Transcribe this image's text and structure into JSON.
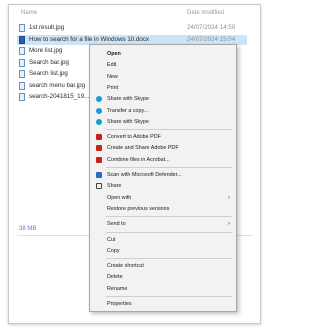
{
  "header": {
    "name": "Name",
    "date": "Date modified"
  },
  "files": [
    {
      "name": "1st result.jpg",
      "date": "24/07/2024 14:50",
      "selected": false,
      "icon": "image-file-icon"
    },
    {
      "name": "How to search for a file in Windows 10.docx",
      "date": "24/07/2024 15:04",
      "selected": true,
      "icon": "word-file-icon"
    },
    {
      "name": "More list.jpg",
      "date": "",
      "selected": false,
      "icon": "image-file-icon"
    },
    {
      "name": "Search bar.jpg",
      "date": "",
      "selected": false,
      "icon": "image-file-icon"
    },
    {
      "name": "Search list.jpg",
      "date": "",
      "selected": false,
      "icon": "image-file-icon"
    },
    {
      "name": "search menu bar.jpg",
      "date": "",
      "selected": false,
      "icon": "image-file-icon"
    },
    {
      "name": "search-2041815_19...",
      "date": "",
      "selected": false,
      "icon": "image-file-icon"
    }
  ],
  "status": {
    "size": "38 MB"
  },
  "menu": {
    "items": [
      {
        "label": "Open",
        "bold": true,
        "icon": "",
        "arrow": false,
        "sep_before": false
      },
      {
        "label": "Edit",
        "bold": false,
        "icon": "",
        "arrow": false,
        "sep_before": false
      },
      {
        "label": "New",
        "bold": false,
        "icon": "",
        "arrow": false,
        "sep_before": false
      },
      {
        "label": "Print",
        "bold": false,
        "icon": "",
        "arrow": false,
        "sep_before": false
      },
      {
        "label": "Share with Skype",
        "bold": false,
        "icon": "skype",
        "arrow": false,
        "sep_before": false
      },
      {
        "label": "Transfer a copy...",
        "bold": false,
        "icon": "skype",
        "arrow": false,
        "sep_before": false
      },
      {
        "label": "Share with Skype",
        "bold": false,
        "icon": "skype",
        "arrow": false,
        "sep_before": false
      },
      {
        "label": "Convert to Adobe PDF",
        "bold": false,
        "icon": "pdf",
        "arrow": false,
        "sep_before": true
      },
      {
        "label": "Create and Share Adobe PDF",
        "bold": false,
        "icon": "pdf",
        "arrow": false,
        "sep_before": false
      },
      {
        "label": "Combine files in Acrobat...",
        "bold": false,
        "icon": "pdf",
        "arrow": false,
        "sep_before": false
      },
      {
        "label": "Scan with Microsoft Defender...",
        "bold": false,
        "icon": "defender",
        "arrow": false,
        "sep_before": true
      },
      {
        "label": "Share",
        "bold": false,
        "icon": "share",
        "arrow": false,
        "sep_before": false
      },
      {
        "label": "Open with",
        "bold": false,
        "icon": "",
        "arrow": true,
        "sep_before": false
      },
      {
        "label": "Restore previous versions",
        "bold": false,
        "icon": "",
        "arrow": false,
        "sep_before": false
      },
      {
        "label": "Send to",
        "bold": false,
        "icon": "",
        "arrow": true,
        "sep_before": true
      },
      {
        "label": "Cut",
        "bold": false,
        "icon": "",
        "arrow": false,
        "sep_before": true
      },
      {
        "label": "Copy",
        "bold": false,
        "icon": "",
        "arrow": false,
        "sep_before": false
      },
      {
        "label": "Create shortcut",
        "bold": false,
        "icon": "",
        "arrow": false,
        "sep_before": true
      },
      {
        "label": "Delete",
        "bold": false,
        "icon": "",
        "arrow": false,
        "sep_before": false
      },
      {
        "label": "Rename",
        "bold": false,
        "icon": "",
        "arrow": false,
        "sep_before": false
      },
      {
        "label": "Properties",
        "bold": false,
        "icon": "",
        "arrow": false,
        "sep_before": true
      }
    ]
  },
  "colors": {
    "selection": "#cce4f7",
    "menu_bg": "#f2f2f2",
    "skype": "#1a9bd7",
    "pdf": "#c8241b",
    "defender": "#2b6bc4"
  }
}
